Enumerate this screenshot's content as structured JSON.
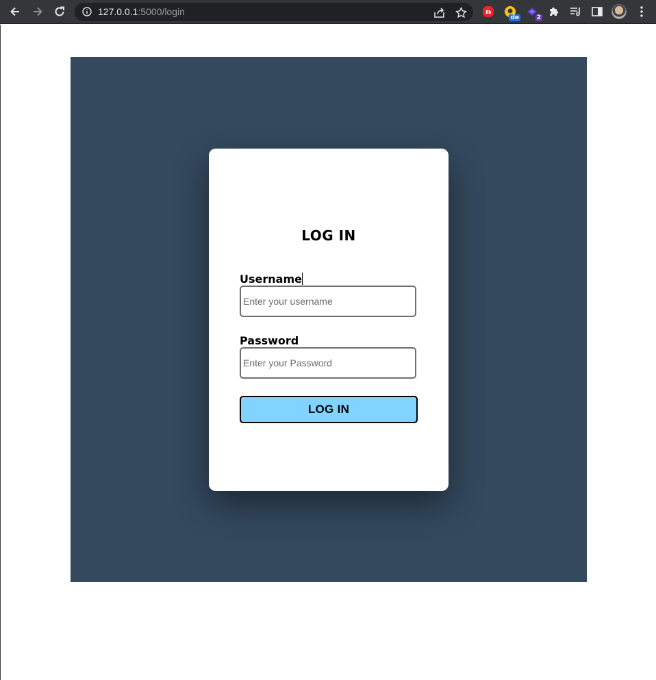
{
  "browser": {
    "url_host": "127.0.0.1",
    "url_path": ":5000/login",
    "extensions": [
      {
        "name": "adblock-extension-icon",
        "color": "#e8232a"
      },
      {
        "name": "translate-extension-icon",
        "badge": "de",
        "color": "#f5c518",
        "badge_color": "#1a73e8"
      },
      {
        "name": "purple-extension-icon",
        "badge": "2",
        "color": "#5b3fd1",
        "badge_color": "#673ab7"
      }
    ]
  },
  "page": {
    "background_color": "#34495e",
    "card_color": "#ffffff"
  },
  "login": {
    "title": "LOG IN",
    "username_label": "Username",
    "username_placeholder": "Enter your username",
    "password_label": "Password",
    "password_placeholder": "Enter your Password",
    "submit_label": "LOG IN",
    "button_color": "#80d4ff"
  }
}
